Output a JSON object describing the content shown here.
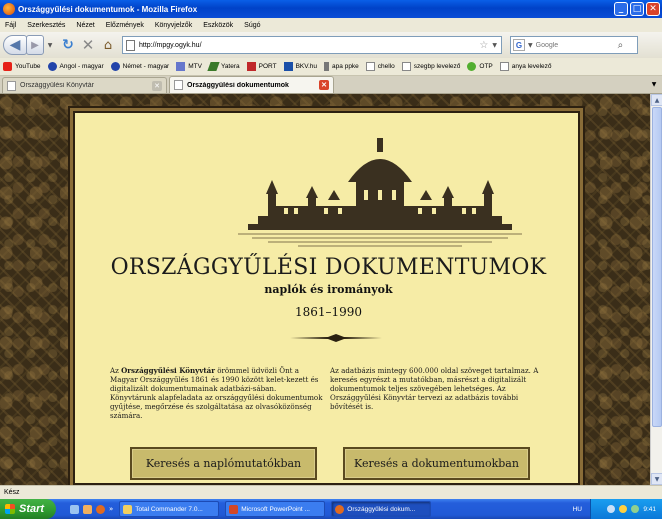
{
  "window": {
    "title": "Országgyűlési dokumentumok - Mozilla Firefox"
  },
  "menu": [
    "Fájl",
    "Szerkesztés",
    "Nézet",
    "Előzmények",
    "Könyvjelzők",
    "Eszközök",
    "Súgó"
  ],
  "nav": {
    "url": "http://mpgy.ogyk.hu/",
    "search_placeholder": "Google"
  },
  "bookmarks": [
    "YouTube",
    "Angol - magyar",
    "Német - magyar",
    "MTV",
    "Yatera",
    "PORT",
    "BKV.hu",
    "apa ppke",
    "chello",
    "szegbp levelező",
    "OTP",
    "anya levelező"
  ],
  "tabs": [
    {
      "label": "Országgyűlési Könyvtár"
    },
    {
      "label": "Országgyűlési dokumentumok"
    }
  ],
  "page": {
    "title": "ORSZÁGGYŰLÉSI DOKUMENTUMOK",
    "subtitle": "naplók és irományok",
    "years": "1861–1990",
    "left_intro_a": "Az ",
    "left_bold": "Országgyűlési Könyvtár",
    "left_intro_b": " örömmel üdvözli Önt a Magyar Országgyűlés 1861 és 1990 között kelet-kezett és digitalizált dokumentumainak adatbázi-sában. Könyvtárunk alapfeladata az országgyűlési dokumentumok gyűjtése, megőrzése és szolgáltatása az olvasóközönség számára.",
    "right_text": "Az adatbázis mintegy 600.000 oldal szöveget tartalmaz. A keresés egyrészt a mutatókban, másrészt a digitalizált dokumentumok teljes szövegében lehetséges. Az Országgyűlési Könyvtár tervezi az adatbázis további bővítését is.",
    "btn_index": "Keresés a naplómutatókban",
    "btn_docs": "Keresés a dokumentumokban"
  },
  "status": "Kész",
  "taskbar": {
    "start": "Start",
    "tasks": [
      "Total Commander 7.0...",
      "Microsoft PowerPoint ...",
      "Országgyűlési dokum..."
    ],
    "lang": "HU",
    "time": "9:41"
  },
  "colors": {
    "panel": "#f6eca6",
    "titlebar": "#0a5fe8",
    "button": "#c8ba6c"
  }
}
